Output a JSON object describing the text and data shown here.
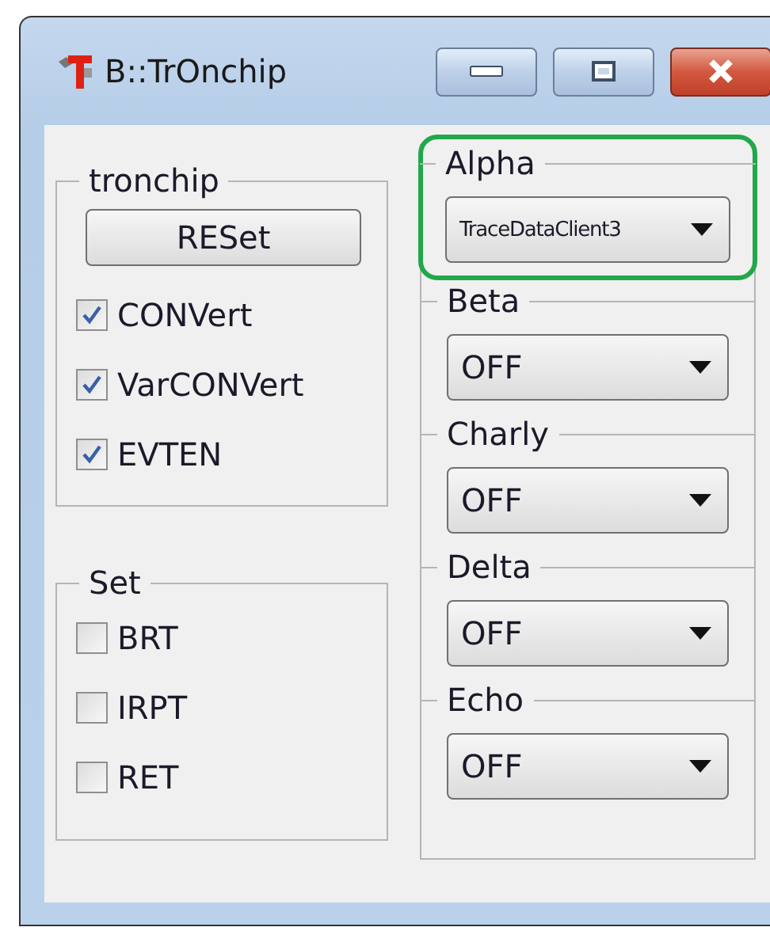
{
  "window": {
    "title": "B::TrOnchip"
  },
  "tronchip": {
    "title": "tronchip",
    "button": "RESet",
    "options": [
      {
        "label": "CONVert",
        "checked": true
      },
      {
        "label": "VarCONVert",
        "checked": true
      },
      {
        "label": "EVTEN",
        "checked": true
      }
    ]
  },
  "set": {
    "title": "Set",
    "options": [
      {
        "label": "BRT",
        "checked": false
      },
      {
        "label": "IRPT",
        "checked": false
      },
      {
        "label": "RET",
        "checked": false
      }
    ]
  },
  "channels": [
    {
      "label": "Alpha",
      "value": "TraceDataClient3",
      "highlighted": true
    },
    {
      "label": "Beta",
      "value": "OFF",
      "highlighted": false
    },
    {
      "label": "Charly",
      "value": "OFF",
      "highlighted": false
    },
    {
      "label": "Delta",
      "value": "OFF",
      "highlighted": false
    },
    {
      "label": "Echo",
      "value": "OFF",
      "highlighted": false
    }
  ]
}
